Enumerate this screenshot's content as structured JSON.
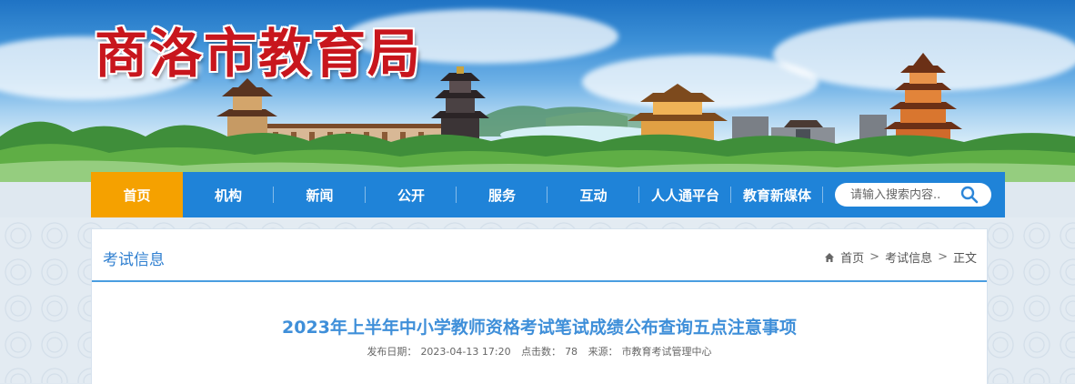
{
  "site": {
    "title": "商洛市教育局"
  },
  "nav": {
    "items": [
      {
        "label": "首页",
        "active": true
      },
      {
        "label": "机构"
      },
      {
        "label": "新闻"
      },
      {
        "label": "公开"
      },
      {
        "label": "服务"
      },
      {
        "label": "互动"
      },
      {
        "label": "人人通平台"
      },
      {
        "label": "教育新媒体"
      }
    ]
  },
  "search": {
    "placeholder": "请输入搜索内容..",
    "icon": "search-icon"
  },
  "section": {
    "title": "考试信息"
  },
  "breadcrumb": {
    "home": "首页",
    "section": "考试信息",
    "current": "正文",
    "separator": ">"
  },
  "article": {
    "title": "2023年上半年中小学教师资格考试笔试成绩公布查询五点注意事项",
    "date_label": "发布日期：",
    "date": "2023-04-13 17:20",
    "clicks_label": "点击数：",
    "clicks": "78",
    "source_label": "来源：",
    "source": "市教育考试管理中心"
  },
  "colors": {
    "nav_bg": "#1f83d8",
    "nav_active": "#f5a100",
    "title_red": "#c8161d",
    "accent_blue": "#3f8fd9"
  }
}
